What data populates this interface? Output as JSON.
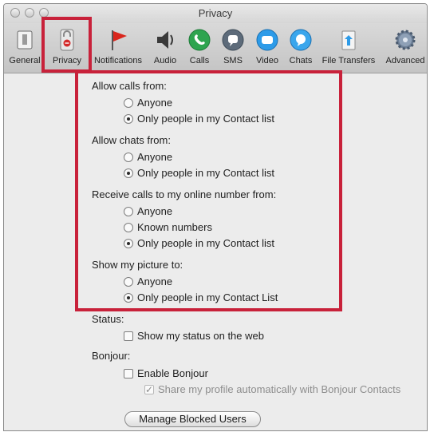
{
  "window": {
    "title": "Privacy"
  },
  "toolbar": {
    "items": [
      {
        "label": "General",
        "icon": "general-switch-icon"
      },
      {
        "label": "Privacy",
        "icon": "privacy-lock-icon"
      },
      {
        "label": "Notifications",
        "icon": "flag-icon"
      },
      {
        "label": "Audio",
        "icon": "speaker-icon"
      },
      {
        "label": "Calls",
        "icon": "phone-icon"
      },
      {
        "label": "SMS",
        "icon": "sms-icon"
      },
      {
        "label": "Video",
        "icon": "video-icon"
      },
      {
        "label": "Chats",
        "icon": "chat-bubble-icon"
      },
      {
        "label": "File Transfers",
        "icon": "file-transfer-icon"
      },
      {
        "label": "Advanced",
        "icon": "gear-icon"
      }
    ]
  },
  "calls": {
    "label": "Allow calls from:",
    "options": [
      "Anyone",
      "Only people in my Contact list"
    ],
    "selected": "Only people in my Contact list"
  },
  "chats": {
    "label": "Allow chats from:",
    "options": [
      "Anyone",
      "Only people in my Contact list"
    ],
    "selected": "Only people in my Contact list"
  },
  "online_number": {
    "label": "Receive calls to my online number from:",
    "options": [
      "Anyone",
      "Known numbers",
      "Only people in my Contact list"
    ],
    "selected": "Only people in my Contact list"
  },
  "picture": {
    "label": "Show my picture to:",
    "options": [
      "Anyone",
      "Only people in my Contact List"
    ],
    "selected": "Only people in my Contact List"
  },
  "status": {
    "label": "Status:",
    "checkbox": "Show my status on the web",
    "checked": false
  },
  "bonjour": {
    "label": "Bonjour:",
    "enable_checkbox": "Enable Bonjour",
    "enable_checked": false,
    "share_checkbox": "Share my profile automatically with Bonjour Contacts",
    "share_checked": true,
    "share_disabled": true
  },
  "buttons": {
    "manage_blocked": "Manage Blocked Users"
  },
  "colors": {
    "highlight": "#c8213a",
    "toolbar": "#cfcfcf",
    "background": "#ececec"
  }
}
